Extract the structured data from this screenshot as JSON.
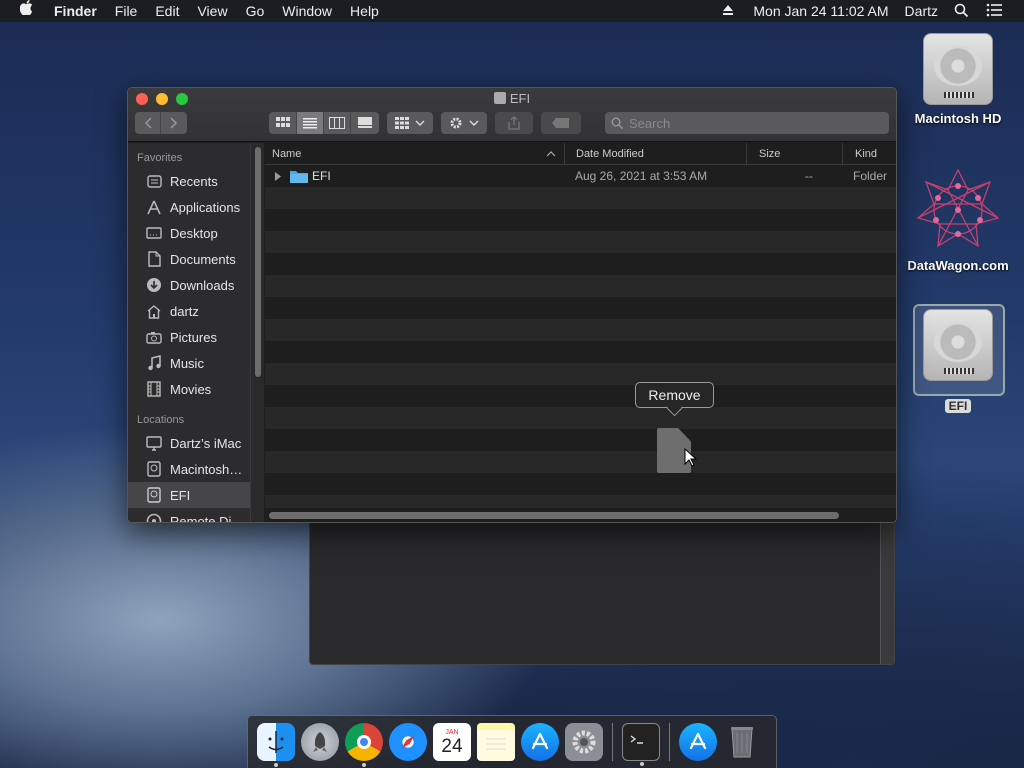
{
  "menubar": {
    "apple": "",
    "app": "Finder",
    "items": [
      "File",
      "Edit",
      "View",
      "Go",
      "Window",
      "Help"
    ],
    "clock": "Mon Jan 24  11:02 AM",
    "user": "Dartz"
  },
  "window": {
    "title": "EFI",
    "search_placeholder": "Search",
    "sidebar": {
      "favorites_label": "Favorites",
      "favorites": [
        {
          "label": "Recents",
          "icon": "clock-icon"
        },
        {
          "label": "Applications",
          "icon": "applications-icon"
        },
        {
          "label": "Desktop",
          "icon": "desktop-icon"
        },
        {
          "label": "Documents",
          "icon": "document-icon"
        },
        {
          "label": "Downloads",
          "icon": "download-icon"
        },
        {
          "label": "dartz",
          "icon": "home-icon"
        },
        {
          "label": "Pictures",
          "icon": "camera-icon"
        },
        {
          "label": "Music",
          "icon": "music-icon"
        },
        {
          "label": "Movies",
          "icon": "film-icon"
        }
      ],
      "locations_label": "Locations",
      "locations": [
        {
          "label": "Dartz’s iMac",
          "icon": "computer-icon"
        },
        {
          "label": "Macintosh…",
          "icon": "disk-icon"
        },
        {
          "label": "EFI",
          "icon": "disk-icon"
        },
        {
          "label": "Remote Di…",
          "icon": "disc-icon"
        }
      ]
    },
    "columns": {
      "name": "Name",
      "date": "Date Modified",
      "size": "Size",
      "kind": "Kind"
    },
    "files": [
      {
        "name": "EFI",
        "date": "Aug 26, 2021 at 3:53 AM",
        "size": "--",
        "kind": "Folder"
      }
    ]
  },
  "tooltip": "Remove",
  "desktop": {
    "icons": [
      {
        "label": "Macintosh HD"
      },
      {
        "label": "DataWagon.com"
      },
      {
        "label": "EFI"
      }
    ]
  },
  "dock": {
    "calendar_day": "24",
    "calendar_month": "JAN"
  }
}
